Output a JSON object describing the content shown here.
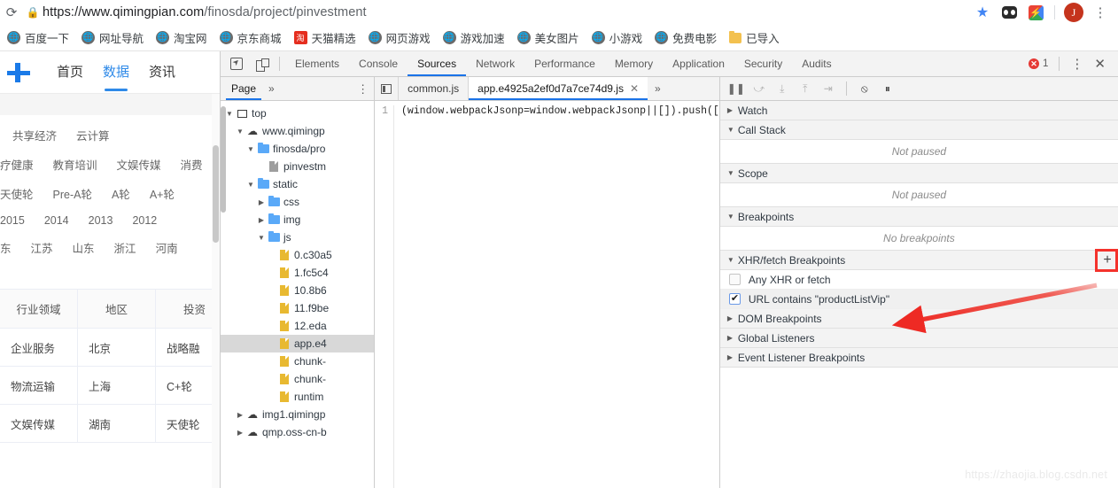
{
  "browser": {
    "reload_icon": "reload-icon",
    "lock_icon": "lock-icon",
    "url_domain": "https://www.qimingpian.com",
    "url_path": "/finosda/project/pinvestment",
    "star_icon": "★",
    "profile_initial": "J",
    "menu_icon": "⋮",
    "bookmarks": [
      {
        "label": "百度一下",
        "icon": "globe-icon",
        "kind": "globe"
      },
      {
        "label": "网址导航",
        "icon": "globe-icon",
        "kind": "globe"
      },
      {
        "label": "淘宝网",
        "icon": "globe-icon",
        "kind": "globe"
      },
      {
        "label": "京东商城",
        "icon": "globe-icon",
        "kind": "globe"
      },
      {
        "label": "天猫精选",
        "icon": "tmall-icon",
        "kind": "red",
        "glyph": "淘"
      },
      {
        "label": "网页游戏",
        "icon": "globe-icon",
        "kind": "globe"
      },
      {
        "label": "游戏加速",
        "icon": "globe-icon",
        "kind": "globe"
      },
      {
        "label": "美女图片",
        "icon": "globe-icon",
        "kind": "globe"
      },
      {
        "label": "小游戏",
        "icon": "globe-icon",
        "kind": "globe"
      },
      {
        "label": "免费电影",
        "icon": "globe-icon",
        "kind": "globe"
      },
      {
        "label": "已导入",
        "icon": "folder-icon",
        "kind": "folder"
      }
    ]
  },
  "webpage": {
    "nav_items": [
      {
        "label": "首页",
        "active": false
      },
      {
        "label": "数据",
        "active": true
      },
      {
        "label": "资讯",
        "active": false
      }
    ],
    "filter_rows": [
      [
        "共享经济",
        "云计算"
      ],
      [
        "疗健康",
        "教育培训",
        "文娱传媒",
        "消费"
      ],
      [
        "天使轮",
        "Pre-A轮",
        "A轮",
        "A+轮"
      ],
      [
        "2015",
        "2014",
        "2013",
        "2012"
      ],
      [
        "东",
        "江苏",
        "山东",
        "浙江",
        "河南"
      ]
    ],
    "table": {
      "headers": [
        "行业领域",
        "地区",
        "投资"
      ],
      "rows": [
        [
          "企业服务",
          "北京",
          "战略融"
        ],
        [
          "物流运输",
          "上海",
          "C+轮"
        ],
        [
          "文娱传媒",
          "湖南",
          "天使轮"
        ]
      ]
    }
  },
  "devtools": {
    "inspect_icon": "inspect-element-icon",
    "device_icon": "device-toolbar-icon",
    "tabs": [
      {
        "label": "Elements",
        "active": false
      },
      {
        "label": "Console",
        "active": false
      },
      {
        "label": "Sources",
        "active": true
      },
      {
        "label": "Network",
        "active": false
      },
      {
        "label": "Performance",
        "active": false
      },
      {
        "label": "Memory",
        "active": false
      },
      {
        "label": "Application",
        "active": false
      },
      {
        "label": "Security",
        "active": false
      },
      {
        "label": "Audits",
        "active": false
      }
    ],
    "error_count": "1",
    "more_icon": "⋮",
    "close_icon": "✕",
    "navigator": {
      "tab_label": "Page",
      "more_tabs_icon": "»",
      "menu_icon": "⋮",
      "tree": [
        {
          "label": "top",
          "depth": 0,
          "twisty": "▼",
          "icon": "frame-icon",
          "selected": false
        },
        {
          "label": "www.qimingp",
          "depth": 1,
          "twisty": "▼",
          "icon": "cloud-icon",
          "selected": false
        },
        {
          "label": "finosda/pro",
          "depth": 2,
          "twisty": "▼",
          "icon": "folder-icon",
          "selected": false
        },
        {
          "label": "pinvestm",
          "depth": 3,
          "twisty": "",
          "icon": "document-icon",
          "selected": false
        },
        {
          "label": "static",
          "depth": 2,
          "twisty": "▼",
          "icon": "folder-icon",
          "selected": false
        },
        {
          "label": "css",
          "depth": 3,
          "twisty": "▶",
          "icon": "folder-icon",
          "selected": false
        },
        {
          "label": "img",
          "depth": 3,
          "twisty": "▶",
          "icon": "folder-icon",
          "selected": false
        },
        {
          "label": "js",
          "depth": 3,
          "twisty": "▼",
          "icon": "folder-icon",
          "selected": false
        },
        {
          "label": "0.c30a5",
          "depth": 4,
          "twisty": "",
          "icon": "js-file-icon",
          "selected": false
        },
        {
          "label": "1.fc5c4",
          "depth": 4,
          "twisty": "",
          "icon": "js-file-icon",
          "selected": false
        },
        {
          "label": "10.8b6",
          "depth": 4,
          "twisty": "",
          "icon": "js-file-icon",
          "selected": false
        },
        {
          "label": "11.f9be",
          "depth": 4,
          "twisty": "",
          "icon": "js-file-icon",
          "selected": false
        },
        {
          "label": "12.eda",
          "depth": 4,
          "twisty": "",
          "icon": "js-file-icon",
          "selected": false
        },
        {
          "label": "app.e4",
          "depth": 4,
          "twisty": "",
          "icon": "js-file-icon",
          "selected": true
        },
        {
          "label": "chunk-",
          "depth": 4,
          "twisty": "",
          "icon": "js-file-icon",
          "selected": false
        },
        {
          "label": "chunk-",
          "depth": 4,
          "twisty": "",
          "icon": "js-file-icon",
          "selected": false
        },
        {
          "label": "runtim",
          "depth": 4,
          "twisty": "",
          "icon": "js-file-icon",
          "selected": false
        },
        {
          "label": "img1.qimingp",
          "depth": 1,
          "twisty": "▶",
          "icon": "cloud-icon",
          "selected": false
        },
        {
          "label": "qmp.oss-cn-b",
          "depth": 1,
          "twisty": "▶",
          "icon": "cloud-icon",
          "selected": false
        }
      ]
    },
    "editor": {
      "show_navigator_icon": "show-navigator-icon",
      "tabs": [
        {
          "label": "common.js",
          "active": false,
          "closable": false
        },
        {
          "label": "app.e4925a2ef0d7a7ce74d9.js",
          "active": true,
          "closable": true,
          "close_icon": "✕"
        }
      ],
      "more_tabs_icon": "»",
      "line_number": "1",
      "code": "(window.webpackJsonp=window.webpackJsonp||[]).push(["
    },
    "debugger": {
      "toolbar_icons": [
        {
          "name": "resume-script-icon",
          "glyph": "❚❚"
        },
        {
          "name": "step-over-icon",
          "glyph": "⤻"
        },
        {
          "name": "step-into-icon",
          "glyph": "⤓"
        },
        {
          "name": "step-out-icon",
          "glyph": "⤒"
        },
        {
          "name": "step-icon",
          "glyph": "⇥"
        },
        {
          "name": "deactivate-breakpoints-icon",
          "glyph": "⦸"
        },
        {
          "name": "pause-on-exceptions-icon",
          "glyph": "⏸"
        }
      ],
      "sections": [
        {
          "name": "watch",
          "title": "Watch",
          "twisty": "▶",
          "empty": null
        },
        {
          "name": "call-stack",
          "title": "Call Stack",
          "twisty": "▼",
          "empty": "Not paused"
        },
        {
          "name": "scope",
          "title": "Scope",
          "twisty": "▼",
          "empty": "Not paused"
        },
        {
          "name": "breakpoints",
          "title": "Breakpoints",
          "twisty": "▼",
          "empty": "No breakpoints"
        }
      ],
      "xhr_section": {
        "title": "XHR/fetch Breakpoints",
        "twisty": "▼",
        "add_icon": "+",
        "rows": [
          {
            "label": "Any XHR or fetch",
            "checked": false
          },
          {
            "label": "URL contains \"productListVip\"",
            "checked": true
          }
        ]
      },
      "bottom_sections": [
        {
          "name": "dom-breakpoints",
          "title": "DOM Breakpoints",
          "twisty": "▶"
        },
        {
          "name": "global-listeners",
          "title": "Global Listeners",
          "twisty": "▶"
        },
        {
          "name": "event-listener-breakpoints",
          "title": "Event Listener Breakpoints",
          "twisty": "▶"
        }
      ]
    }
  },
  "annotation": {
    "highlight_color": "#f4322c",
    "arrow_name": "red-annotation-arrow"
  },
  "watermark": "https://zhaojia.blog.csdn.net"
}
